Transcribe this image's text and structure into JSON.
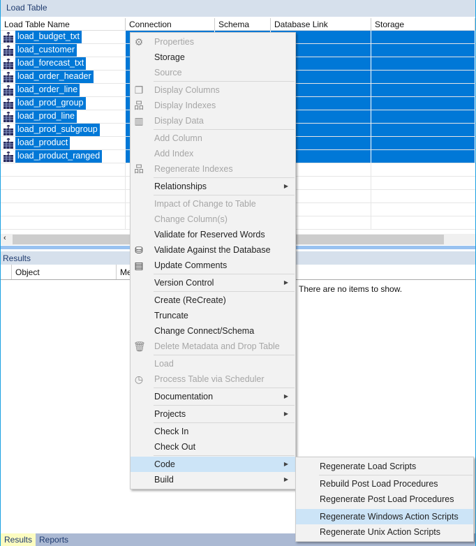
{
  "top_panel": {
    "title": "Load Table",
    "columns": [
      "Load Table Name",
      "Connection",
      "Schema",
      "Database Link",
      "Storage"
    ],
    "rows": [
      "load_budget_txt",
      "load_customer",
      "load_forecast_txt",
      "load_order_header",
      "load_order_line",
      "load_prod_group",
      "load_prod_line",
      "load_prod_subgroup",
      "load_product",
      "load_product_ranged"
    ]
  },
  "results_panel": {
    "title": "Results",
    "columns": [
      "Object",
      "Me"
    ],
    "empty_message": "There are no items to show."
  },
  "context_menu": [
    {
      "label": "Properties",
      "disabled": true,
      "icon": "gear-icon"
    },
    {
      "label": "Storage",
      "disabled": false
    },
    {
      "label": "Source",
      "disabled": true
    },
    {
      "sep": true
    },
    {
      "label": "Display Columns",
      "disabled": true,
      "icon": "columns-icon"
    },
    {
      "label": "Display Indexes",
      "disabled": true,
      "icon": "hierarchy-icon"
    },
    {
      "label": "Display Data",
      "disabled": true,
      "icon": "bar-chart-icon"
    },
    {
      "sep": true
    },
    {
      "label": "Add Column",
      "disabled": true
    },
    {
      "label": "Add Index",
      "disabled": true
    },
    {
      "label": "Regenerate Indexes",
      "disabled": true,
      "icon": "hierarchy-icon"
    },
    {
      "sep": true
    },
    {
      "label": "Relationships",
      "disabled": false,
      "submenu": true
    },
    {
      "sep": true
    },
    {
      "label": "Impact of Change to Table",
      "disabled": true
    },
    {
      "label": "Change Column(s)",
      "disabled": true
    },
    {
      "label": "Validate for Reserved Words",
      "disabled": false
    },
    {
      "label": "Validate Against the Database",
      "disabled": false,
      "icon": "database-info-icon"
    },
    {
      "label": "Update Comments",
      "disabled": false,
      "icon": "comment-icon"
    },
    {
      "sep": true
    },
    {
      "label": "Version Control",
      "disabled": false,
      "submenu": true
    },
    {
      "sep": true
    },
    {
      "label": "Create (ReCreate)",
      "disabled": false
    },
    {
      "label": "Truncate",
      "disabled": false
    },
    {
      "label": "Change Connect/Schema",
      "disabled": false
    },
    {
      "label": "Delete Metadata and Drop Table",
      "disabled": true,
      "icon": "trash-icon"
    },
    {
      "sep": true
    },
    {
      "label": "Load",
      "disabled": true
    },
    {
      "label": "Process Table via Scheduler",
      "disabled": true,
      "icon": "clock-icon"
    },
    {
      "sep": true
    },
    {
      "label": "Documentation",
      "disabled": false,
      "submenu": true
    },
    {
      "sep": true
    },
    {
      "label": "Projects",
      "disabled": false,
      "submenu": true
    },
    {
      "sep": true
    },
    {
      "label": "Check In",
      "disabled": false
    },
    {
      "label": "Check Out",
      "disabled": false
    },
    {
      "sep": true
    },
    {
      "label": "Code",
      "disabled": false,
      "submenu": true,
      "highlighted": true
    },
    {
      "label": "Build",
      "disabled": false,
      "submenu": true
    }
  ],
  "code_submenu": [
    {
      "label": "Regenerate Load Scripts"
    },
    {
      "sep": true
    },
    {
      "label": "Rebuild Post Load Procedures"
    },
    {
      "label": "Regenerate Post Load Procedures"
    },
    {
      "sep": true,
      "blank": true
    },
    {
      "label": "Regenerate Windows Action Scripts",
      "highlighted": true
    },
    {
      "label": "Regenerate Unix Action Scripts"
    }
  ],
  "bottom_tabs": [
    {
      "label": "Results",
      "active": true
    },
    {
      "label": "Reports",
      "active": false
    }
  ]
}
